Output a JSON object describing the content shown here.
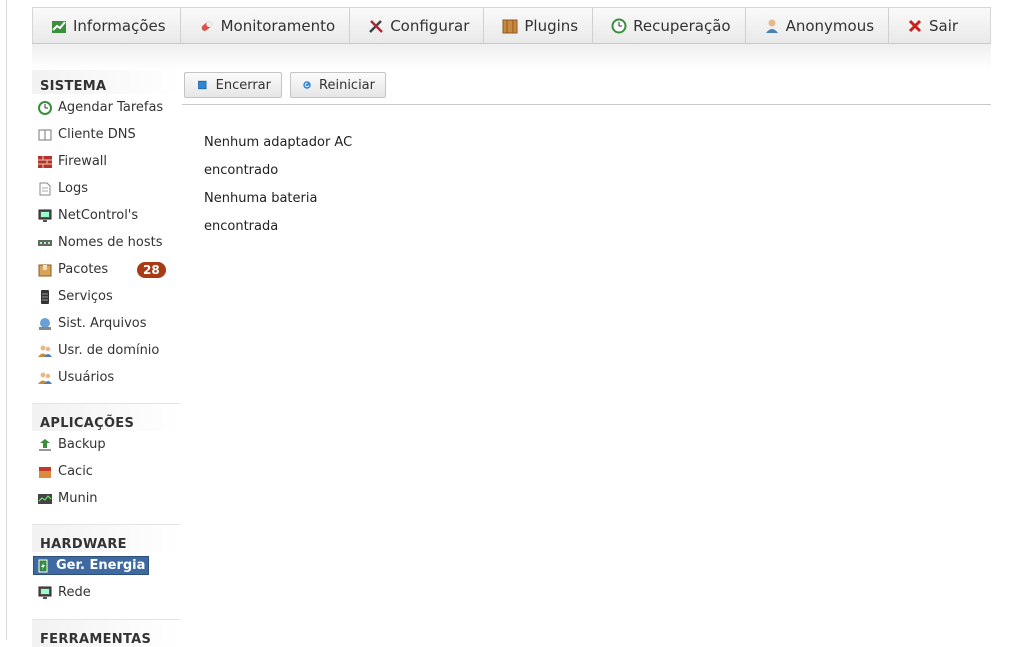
{
  "topnav": {
    "items": [
      {
        "label": "Informações",
        "icon": "chart-icon"
      },
      {
        "label": "Monitoramento",
        "icon": "pill-icon"
      },
      {
        "label": "Configurar",
        "icon": "tools-icon"
      },
      {
        "label": "Plugins",
        "icon": "box-icon"
      },
      {
        "label": "Recuperação",
        "icon": "clock-icon"
      },
      {
        "label": "Anonymous",
        "icon": "user-icon"
      },
      {
        "label": "Sair",
        "icon": "close-icon"
      }
    ]
  },
  "sidebar": {
    "sistema": {
      "title": "SISTEMA",
      "items": [
        "Agendar Tarefas",
        "Cliente DNS",
        "Firewall",
        "Logs",
        "NetControl's",
        "Nomes de hosts",
        "Pacotes",
        "Serviços",
        "Sist. Arquivos",
        "Usr. de domínio",
        "Usuários"
      ],
      "pacotes_badge": "28"
    },
    "aplicacoes": {
      "title": "APLICAÇÕES",
      "items": [
        "Backup",
        "Cacic",
        "Munin"
      ]
    },
    "hardware": {
      "title": "HARDWARE",
      "items": [
        "Ger. Energia",
        "Rede"
      ]
    },
    "ferramentas": {
      "title": "FERRAMENTAS"
    }
  },
  "toolbar": {
    "shutdown_label": "Encerrar",
    "restart_label": "Reiniciar"
  },
  "main": {
    "messages": [
      "Nenhum adaptador AC",
      "encontrado",
      "Nenhuma bateria",
      "encontrada"
    ]
  },
  "colors": {
    "active_bg": "#3f6aa1",
    "badge_bg": "#a83a14"
  }
}
